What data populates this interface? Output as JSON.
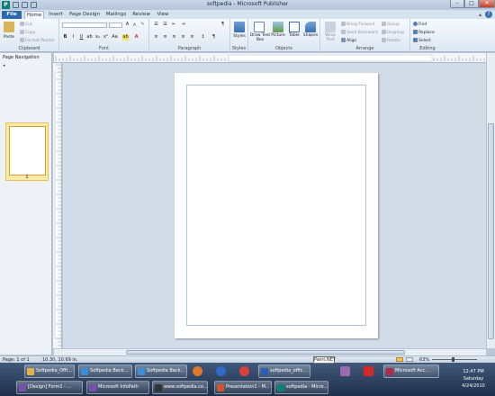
{
  "window": {
    "title": "softpedia - Microsoft Publisher",
    "app_icon": "P",
    "minimize": "–",
    "maximize": "□",
    "close": "✕"
  },
  "tabs": [
    "File",
    "Home",
    "Insert",
    "Page Design",
    "Mailings",
    "Review",
    "View"
  ],
  "help": "?",
  "ribbon": {
    "clipboard": {
      "paste": "Paste",
      "cut": "Cut",
      "copy": "Copy",
      "format_painter": "Format Painter",
      "label": "Clipboard"
    },
    "font": {
      "bold": "B",
      "italic": "I",
      "underline": "U",
      "label": "Font"
    },
    "paragraph": {
      "label": "Paragraph",
      "pilcrow": "¶"
    },
    "styles": {
      "styles": "Styles",
      "label": "Styles"
    },
    "objects": {
      "draw_text_box": "Draw Text Box",
      "picture": "Picture",
      "table": "Table",
      "shapes": "Shapes",
      "label": "Objects"
    },
    "arrange": {
      "wrap_text": "Wrap Text",
      "bring_forward": "Bring Forward",
      "send_backward": "Send Backward",
      "align": "Align",
      "group": "Group",
      "ungroup": "Ungroup",
      "rotate": "Rotate",
      "label": "Arrange"
    },
    "editing": {
      "find": "Find",
      "replace": "Replace",
      "select": "Select",
      "label": "Editing"
    }
  },
  "nav_pane": {
    "title": "Page Navigation",
    "page_number": "1"
  },
  "status": {
    "page": "Page: 1 of 1",
    "position": "10.30, 10.69 in.",
    "zoom": "63%"
  },
  "taskbar": {
    "row1": [
      {
        "label": "Softpedia_Offi...",
        "color": "#e2b24a"
      },
      {
        "label": "Softpedia Back...",
        "color": "#3a8fd8"
      },
      {
        "label": "Softpedia Back...",
        "color": "#3a8fd8"
      },
      {
        "label": "softpedia_offic...",
        "color": "#2b5db5"
      },
      {
        "label": "Microsoft Acc...",
        "color": "#b02a4a"
      }
    ],
    "row2": [
      {
        "label": "[Design] Form1 - ...",
        "color": "#7a4fb0"
      },
      {
        "label": "Microsoft InfoPath",
        "color": "#7a4fb0"
      },
      {
        "label": "www.softpedia.co...",
        "color": "#333"
      },
      {
        "label": "Presentation1 - M...",
        "color": "#d0532b"
      },
      {
        "label": "softpedia - Micro...",
        "color": "#0f7f7a"
      }
    ],
    "tooltip": "Paint.NET",
    "clock": {
      "time": "12:47 PM",
      "day": "Saturday",
      "date": "4/24/2010"
    }
  }
}
